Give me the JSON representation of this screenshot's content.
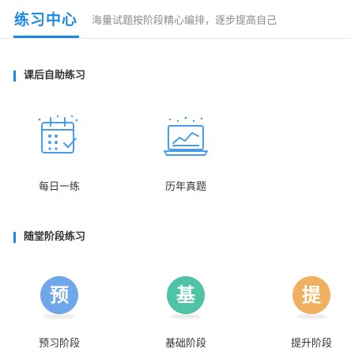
{
  "header": {
    "title": "练习中心",
    "subtitle": "海量试题按阶段精心编排，逐步提高自己"
  },
  "sections": [
    {
      "title": "课后自助练习",
      "items": [
        {
          "label": "每日一练",
          "icon": "calendar-check-icon"
        },
        {
          "label": "历年真题",
          "icon": "laptop-chart-icon"
        }
      ]
    },
    {
      "title": "随堂阶段练习",
      "items": [
        {
          "label": "预习阶段",
          "glyph": "预",
          "color": "#6fa8e8"
        },
        {
          "label": "基础阶段",
          "glyph": "基",
          "color": "#4fc3a5"
        },
        {
          "label": "提升阶段",
          "glyph": "提",
          "color": "#f0b060"
        }
      ]
    }
  ],
  "colors": {
    "accent": "#1e88e5",
    "icon_line": "#4a9be8"
  }
}
